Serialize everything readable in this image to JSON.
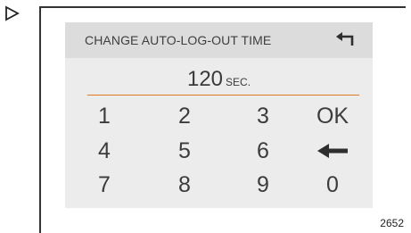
{
  "marker_icon": "triangle-right-outline-icon",
  "dialog": {
    "title": "CHANGE AUTO-LOG-OUT TIME",
    "back_icon": "return-arrow-icon",
    "value": "120",
    "unit": "SEC.",
    "accent_color": "#e07a1f"
  },
  "keypad": {
    "keys": [
      "1",
      "2",
      "3",
      "OK",
      "4",
      "5",
      "6",
      "",
      "7",
      "8",
      "9",
      "0"
    ],
    "backspace_icon": "left-arrow-backspace-icon"
  },
  "figure_number": "2652"
}
